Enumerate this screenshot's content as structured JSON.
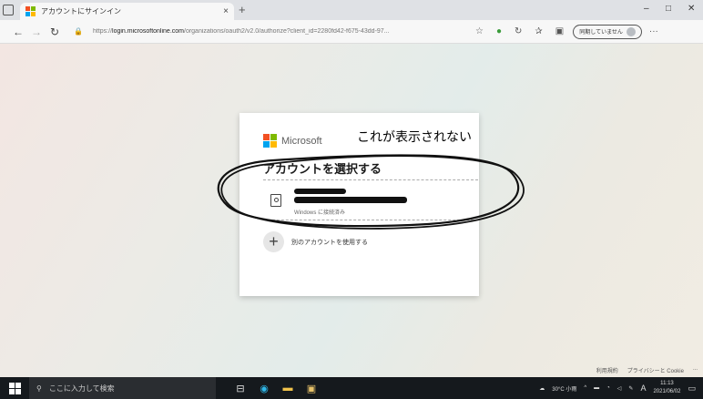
{
  "browser": {
    "tab_title": "アカウントにサインイン",
    "tab_close": "×",
    "new_tab": "+",
    "window_controls": {
      "minimize": "–",
      "maximize": "□",
      "close": "✕"
    },
    "nav": {
      "back": "←",
      "forward": "→",
      "refresh": "↻"
    },
    "lock_icon": "🔒",
    "url_prefix": "https://",
    "url_host": "login.microsoftonline.com",
    "url_path": "/organizations/oauth2/v2.0/authorize?client_id=2280fd42-f675-43dd-97...",
    "sync_status": "同期していません",
    "more": "···"
  },
  "card": {
    "brand": "Microsoft",
    "title": "アカウントを選択する",
    "account_status": "Windows に接続済み",
    "add_account_label": "別のアカウントを使用する"
  },
  "annotation": "これが表示されない",
  "footer": {
    "terms": "利用規約",
    "privacy": "プライバシーと Cookie",
    "more": "..."
  },
  "taskbar": {
    "search_placeholder": "ここに入力して検索",
    "weather": "30°C 小雨",
    "ime": "A",
    "time": "11:13",
    "date": "2021/06/02"
  },
  "colors": {
    "ms_red": "#f25022",
    "ms_green": "#7fba00",
    "ms_blue": "#00a4ef",
    "ms_yellow": "#ffb900"
  }
}
